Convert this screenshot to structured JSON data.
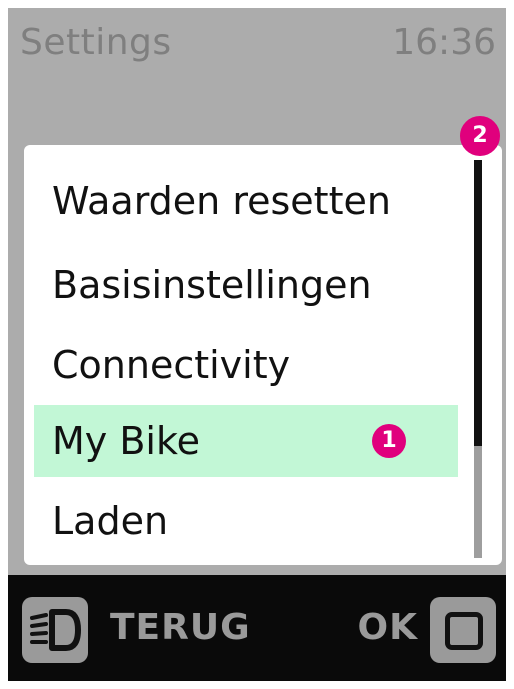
{
  "header": {
    "title": "Settings",
    "time": "16:36"
  },
  "menu": {
    "items": [
      {
        "label": "Waarden resetten",
        "selected": false
      },
      {
        "label": "Basisinstellingen",
        "selected": false
      },
      {
        "label": "Connectivity",
        "selected": false
      },
      {
        "label": "My Bike",
        "selected": true,
        "badge": "1"
      },
      {
        "label": "Laden",
        "selected": false
      }
    ],
    "corner_badge": "2",
    "scroll_position_fraction": 0.72
  },
  "footer": {
    "back_label": "TERUG",
    "back_icon": "headlight-icon",
    "ok_label": "OK",
    "ok_icon": "square-button-icon"
  },
  "colors": {
    "badge": "#e0007d",
    "selection": "#c2f7d6",
    "dim_background": "#acacac"
  }
}
